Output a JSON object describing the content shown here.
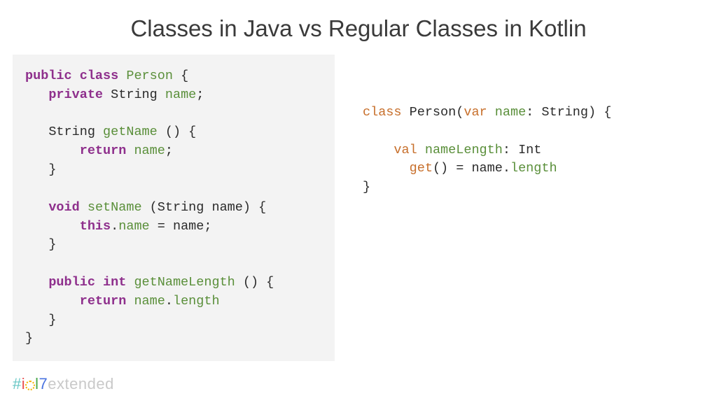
{
  "title": "Classes in Java vs Regular Classes in Kotlin",
  "java": {
    "l1_kw": "public class",
    "l1_nm": " Person ",
    "l1_pl": "{",
    "l2_sp": "   ",
    "l2_kw": "private",
    "l2_pl1": " String ",
    "l2_nm": "name",
    "l2_pl2": ";",
    "l3": "",
    "l4_sp": "   ",
    "l4_pl1": "String ",
    "l4_nm": "getName ",
    "l4_pl2": "() {",
    "l5_sp": "       ",
    "l5_kw": "return",
    "l5_nm": " name",
    "l5_pl": ";",
    "l6_sp": "   ",
    "l6_pl": "}",
    "l7": "",
    "l8_sp": "   ",
    "l8_kw": "void",
    "l8_nm": " setName ",
    "l8_pl": "(String name) {",
    "l9_sp": "       ",
    "l9_kw": "this",
    "l9_pl1": ".",
    "l9_nm": "name ",
    "l9_pl2": "= name;",
    "l10_sp": "   ",
    "l10_pl": "}",
    "l11": "",
    "l12_sp": "   ",
    "l12_kw": "public int",
    "l12_nm": " getNameLength ",
    "l12_pl": "() {",
    "l13_sp": "       ",
    "l13_kw": "return",
    "l13_nm": " name",
    "l13_pl1": ".",
    "l13_nm2": "length",
    "l14_sp": "   ",
    "l14_pl": "}",
    "l15_pl": "}"
  },
  "kotlin": {
    "l1_kw": "class",
    "l1_pl1": " Person(",
    "l1_kw2": "var",
    "l1_nm": " name",
    "l1_pl2": ": String) {",
    "l2": "",
    "l3_sp": "    ",
    "l3_kw": "val",
    "l3_nm": " nameLength",
    "l3_pl": ": Int",
    "l4_sp": "      ",
    "l4_kw": "get",
    "l4_pl1": "() = name.",
    "l4_nm": "length",
    "l5_pl": "}"
  },
  "footer": {
    "hash": "#",
    "i": "i",
    "l": "l",
    "seven": "7",
    "ext": "extended"
  }
}
